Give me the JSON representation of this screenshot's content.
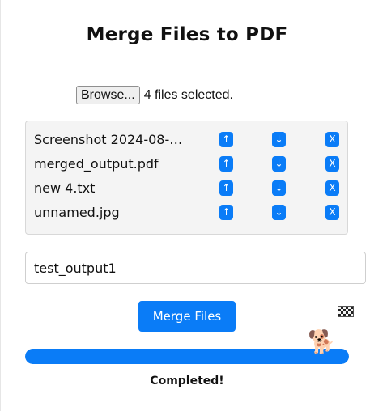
{
  "title": "Merge Files to PDF",
  "file_picker": {
    "browse_label": "Browse...",
    "selected_text": "4 files selected."
  },
  "files": [
    {
      "name": "Screenshot 2024-08-…"
    },
    {
      "name": "merged_output.pdf"
    },
    {
      "name": "new 4.txt"
    },
    {
      "name": "unnamed.jpg"
    }
  ],
  "row_buttons": {
    "up": "↑",
    "down": "↓",
    "remove": "X"
  },
  "output_name": {
    "value": "test_output1"
  },
  "merge_button": "Merge Files",
  "progress": {
    "percent": 100,
    "status": "Completed!"
  },
  "icons": {
    "finish": "checkered-flag-icon",
    "runner": "dog-icon",
    "runner_glyph": "🐕"
  },
  "colors": {
    "accent": "#0a7cf7",
    "list_background": "#f4f4f4"
  }
}
